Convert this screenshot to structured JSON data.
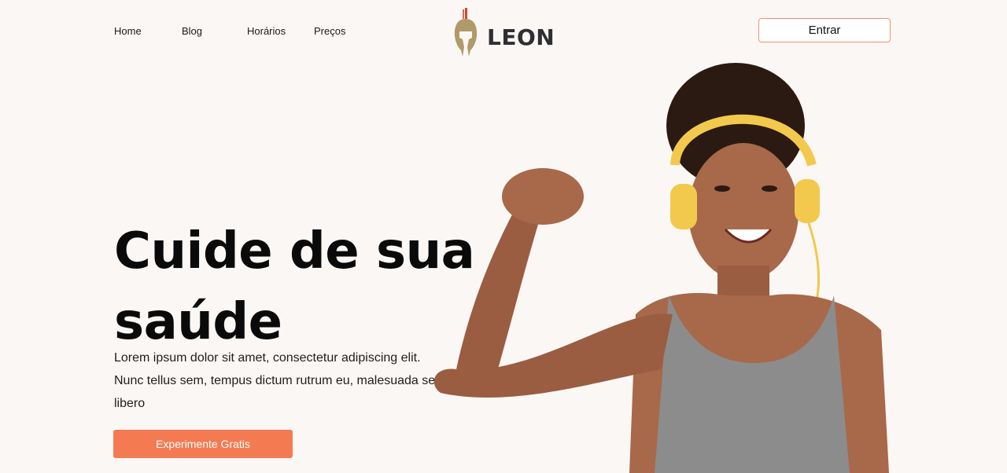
{
  "nav": {
    "items": [
      {
        "label": "Home"
      },
      {
        "label": "Blog"
      },
      {
        "label": "Horários"
      },
      {
        "label": "Preços"
      }
    ]
  },
  "brand": {
    "name": "LEON",
    "accent": "#f47a52",
    "text_color": "#2f2f33",
    "helmet_color": "#b09a6a",
    "crest_color": "#d9442e"
  },
  "header": {
    "login_label": "Entrar"
  },
  "hero": {
    "title_line1": "Cuide de sua",
    "title_line2": "saúde",
    "description": "Lorem ipsum dolor sit amet, consectetur adipiscing elit. Nunc tellus sem, tempus dictum rutrum eu, malesuada sed libero",
    "cta_label": "Experimente Gratis"
  },
  "image": {
    "icon": "woman-flexing-arm-with-headphones"
  }
}
